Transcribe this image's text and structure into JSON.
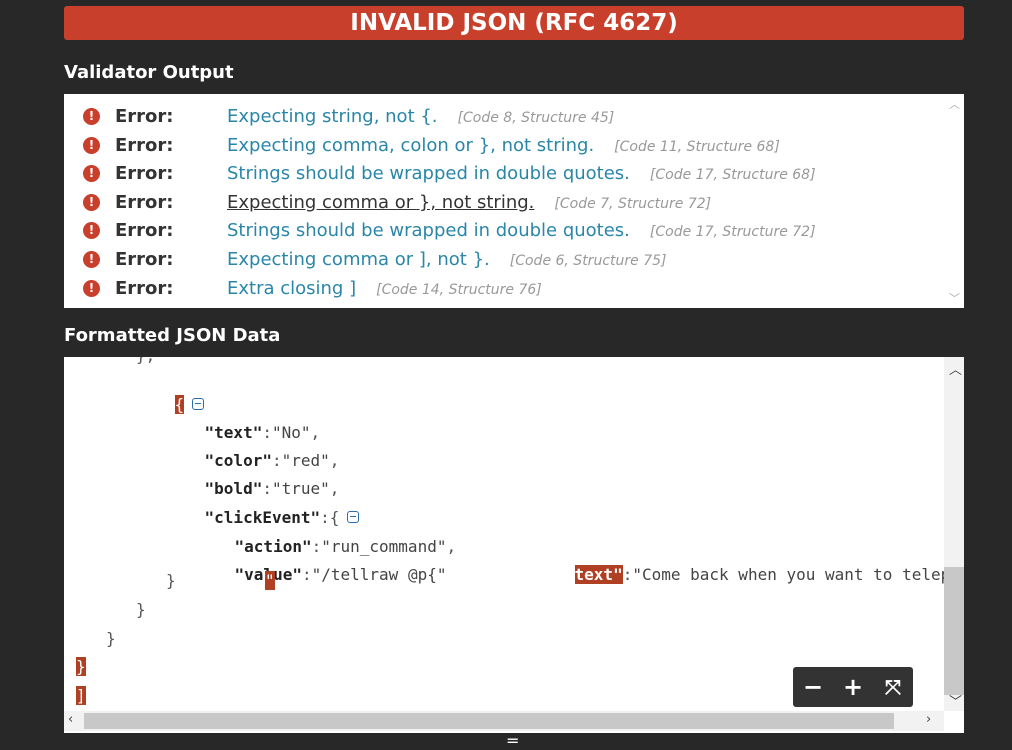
{
  "banner": {
    "title": "INVALID JSON (RFC 4627)"
  },
  "validator": {
    "section_title": "Validator Output",
    "errors": [
      {
        "icon": "error-icon",
        "label": "Error:",
        "message": "Expecting string, not {.",
        "code": "[Code 8, Structure 45]"
      },
      {
        "icon": "error-icon",
        "label": "Error:",
        "message": "Expecting comma, colon or }, not string.",
        "code": "[Code 11, Structure 68]"
      },
      {
        "icon": "error-icon",
        "label": "Error:",
        "message": "Strings should be wrapped in double quotes.",
        "code": "[Code 17, Structure 68]"
      },
      {
        "icon": "error-icon",
        "label": "Error:",
        "message": "Expecting comma or }, not string.",
        "code": "[Code 7, Structure 72]"
      },
      {
        "icon": "error-icon",
        "label": "Error:",
        "message": "Strings should be wrapped in double quotes.",
        "code": "[Code 17, Structure 72]"
      },
      {
        "icon": "error-icon",
        "label": "Error:",
        "message": "Expecting comma or ], not }.",
        "code": "[Code 6, Structure 75]"
      },
      {
        "icon": "error-icon",
        "label": "Error:",
        "message": "Extra closing ]",
        "code": "[Code 14, Structure 76]"
      }
    ]
  },
  "json_view": {
    "section_title": "Formatted JSON Data",
    "lines": {
      "top_partial": "},",
      "open_brace": "{",
      "text_key": "\"text\"",
      "text_val": "\"No\"",
      "color_key": "\"color\"",
      "color_val": "\"red\"",
      "bold_key": "\"bold\"",
      "bold_val": "\"true\"",
      "click_key": "\"clickEvent\"",
      "click_open": "{",
      "action_key": "\"action\"",
      "action_val": "\"run_command\"",
      "value_key": "\"value\"",
      "value_val": "\"/tellraw @p{\"",
      "text2_key": "text\"",
      "text2_val": "\"Come back when you want to telepor",
      "close_inner": "}",
      "stray_quote": "\"",
      "close_mid": "}",
      "close_outer": "}",
      "close_brace": "}",
      "close_bracket": "]"
    }
  },
  "zoom_controls": {
    "minus": "−",
    "plus": "+",
    "fit": "⤧"
  },
  "resize_handle": "="
}
